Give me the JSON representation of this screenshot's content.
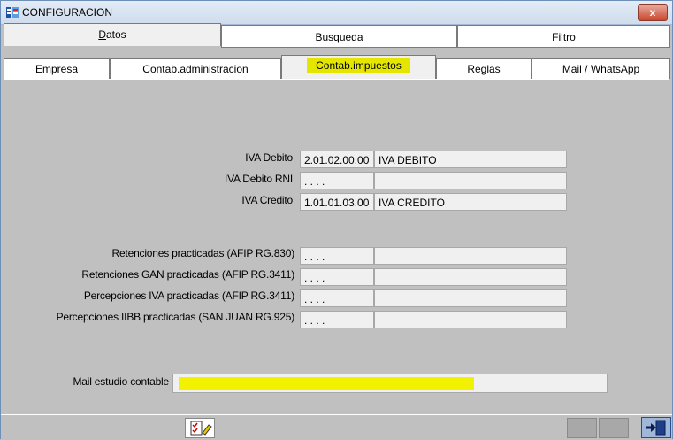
{
  "window": {
    "title": "CONFIGURACION",
    "close_glyph": "x"
  },
  "main_tabs": [
    {
      "label": "Datos",
      "accel": "D",
      "rest": "atos"
    },
    {
      "label": "Busqueda",
      "accel": "B",
      "rest": "usqueda"
    },
    {
      "label": "Filtro",
      "accel": "F",
      "rest": "iltro"
    }
  ],
  "sub_tabs": [
    {
      "label": "Empresa"
    },
    {
      "label": "Contab.administracion"
    },
    {
      "label": "Contab.impuestos"
    },
    {
      "label": "Reglas"
    },
    {
      "label": "Mail / WhatsApp"
    }
  ],
  "iva_rows": [
    {
      "label": "IVA Debito",
      "code": "2.01.02.00.00",
      "name": "IVA DEBITO"
    },
    {
      "label": "IVA Debito RNI",
      "code": ". . . .",
      "name": ""
    },
    {
      "label": "IVA Credito",
      "code": "1.01.01.03.00",
      "name": "IVA CREDITO"
    }
  ],
  "ret_rows": [
    {
      "label": "Retenciones practicadas (AFIP RG.830)",
      "code": ". . . .",
      "name": ""
    },
    {
      "label": "Retenciones GAN practicadas (AFIP RG.3411)",
      "code": ". . . .",
      "name": ""
    },
    {
      "label": "Percepciones IVA practicadas (AFIP RG.3411)",
      "code": ". . . .",
      "name": ""
    },
    {
      "label": "Percepciones IIBB practicadas (SAN JUAN RG.925)",
      "code": ". . . .",
      "name": ""
    }
  ],
  "mail": {
    "label": "Mail estudio contable",
    "value": ""
  },
  "colors": {
    "highlight": "#e5e600",
    "mail_fill": "#f2f200",
    "panel": "#c0c0c0"
  },
  "icons": {
    "app": "app-grid-icon",
    "status": "checklist-pencil-icon",
    "exit": "exit-door-icon"
  }
}
